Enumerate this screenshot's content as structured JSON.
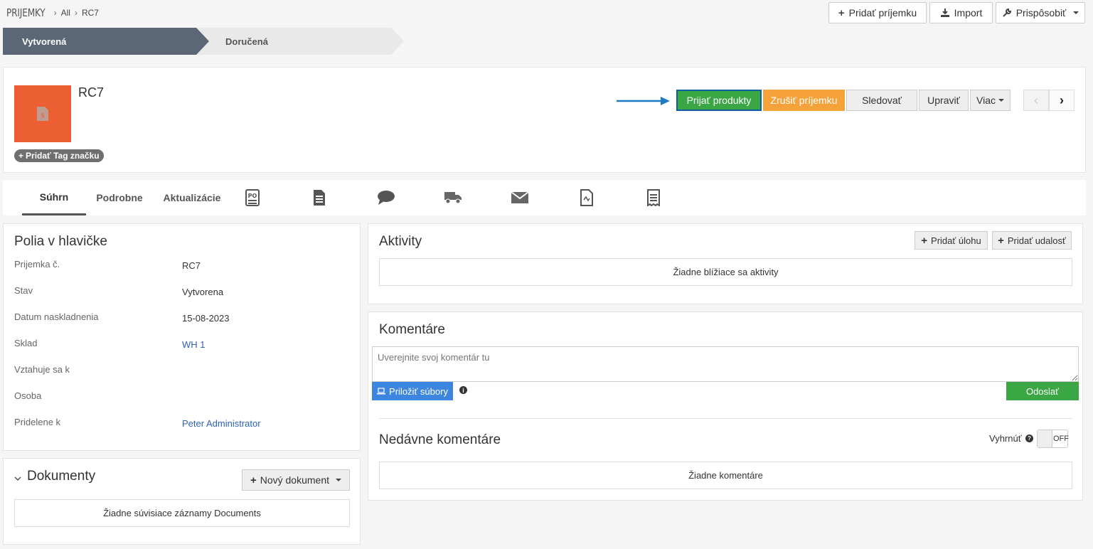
{
  "breadcrumb": {
    "module": "PRIJEMKY",
    "list": "All",
    "record": "RC7"
  },
  "topbar": {
    "add": "Pridať príjemku",
    "import": "Import",
    "customize": "Prispôsobiť"
  },
  "stages": {
    "current": "Vytvorená",
    "next": "Doručená"
  },
  "record": {
    "title": "RC7",
    "tag_button": "Pridať Tag značku",
    "actions": {
      "receive": "Prijať produkty",
      "cancel": "Zrušiť príjemku",
      "follow": "Sledovať",
      "edit": "Upraviť",
      "more": "Viac"
    }
  },
  "tabs": {
    "summary": "Súhrn",
    "detail": "Podrobne",
    "updates": "Aktualizácie"
  },
  "tab_icons": [
    "po-icon",
    "document-icon",
    "chat-bubble-icon",
    "truck-icon",
    "envelope-icon",
    "invoice-icon",
    "receipt-icon"
  ],
  "header_fields": {
    "title": "Polia v hlavičke",
    "rows": [
      {
        "label": "Prijemka č.",
        "value": "RC7"
      },
      {
        "label": "Stav",
        "value": "Vytvorena"
      },
      {
        "label": "Datum naskladnenia",
        "value": "15-08-2023"
      },
      {
        "label": "Sklad",
        "value": "WH 1"
      },
      {
        "label": "Vztahuje sa k",
        "value": ""
      },
      {
        "label": "Osoba",
        "value": ""
      },
      {
        "label": "Pridelene k",
        "value": "Peter Administrator"
      }
    ]
  },
  "documents": {
    "title": "Dokumenty",
    "new_button": "Nový dokument",
    "empty": "Žiadne súvisiace záznamy Documents"
  },
  "activities": {
    "title": "Aktivity",
    "add_task": "Pridať úlohu",
    "add_event": "Pridať udalosť",
    "empty": "Žiadne blížiace sa aktivity"
  },
  "comments": {
    "title": "Komentáre",
    "placeholder": "Uverejnite svoj komentár tu",
    "attach": "Priložiť súbory",
    "send": "Odoslať",
    "recent_title": "Nedávne komentáre",
    "collapse_label": "Vyhrnúť",
    "toggle": "OFF",
    "empty": "Žiadne komentáre"
  },
  "colors": {
    "accent_green": "#3aa744",
    "accent_orange": "#f5a23b",
    "avatar": "#ec5f33",
    "stage_active": "#5b6776"
  }
}
